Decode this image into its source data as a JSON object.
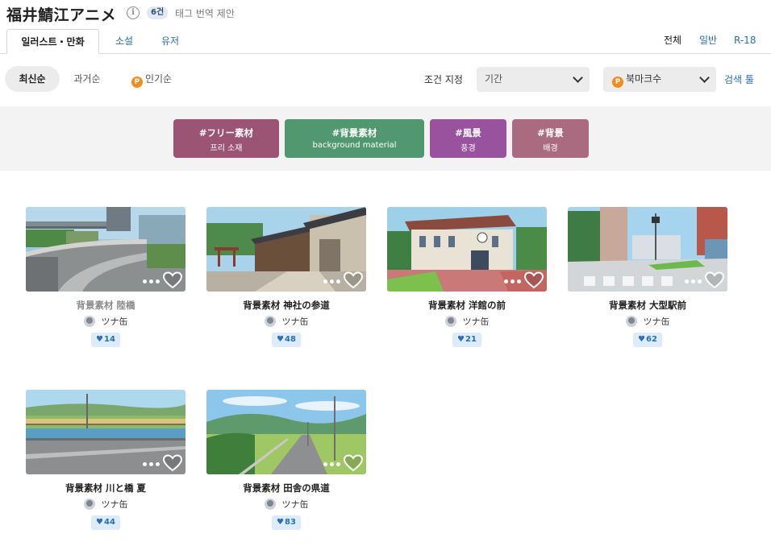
{
  "header": {
    "title": "福井鯖江アニメ",
    "count_badge": "6건",
    "suggest_link": "태그 번역 제안"
  },
  "tabs": {
    "illust": "일러스트・만화",
    "novel": "소설",
    "user": "유저"
  },
  "ratings": {
    "all": "전체",
    "general": "일반",
    "r18": "R-18"
  },
  "sort": {
    "latest": "최신순",
    "old": "과거순",
    "popular": "인기순",
    "premium_icon_letter": "P"
  },
  "filters": {
    "condition_label": "조건 지정",
    "period": "기간",
    "bookmark": "북마크수",
    "search_tool": "검색 툴"
  },
  "tags": [
    {
      "name": "#フリー素材",
      "translation": "프리 소재",
      "color": "#9b5474"
    },
    {
      "name": "#背景素材",
      "translation": "background material",
      "color": "#519871"
    },
    {
      "name": "#風景",
      "translation": "풍경",
      "color": "#98529e"
    },
    {
      "name": "#背景",
      "translation": "배경",
      "color": "#aa6a80"
    }
  ],
  "works": [
    {
      "title": "背景素材 陸橋",
      "author": "ツナ缶",
      "likes": "14"
    },
    {
      "title": "背景素材 神社の参道",
      "author": "ツナ缶",
      "likes": "48"
    },
    {
      "title": "背景素材 洋館の前",
      "author": "ツナ缶",
      "likes": "21"
    },
    {
      "title": "背景素材 大型駅前",
      "author": "ツナ缶",
      "likes": "62"
    },
    {
      "title": "背景素材 川と橋 夏",
      "author": "ツナ缶",
      "likes": "44"
    },
    {
      "title": "背景素材 田舎の県道",
      "author": "ツナ缶",
      "likes": "83"
    }
  ]
}
